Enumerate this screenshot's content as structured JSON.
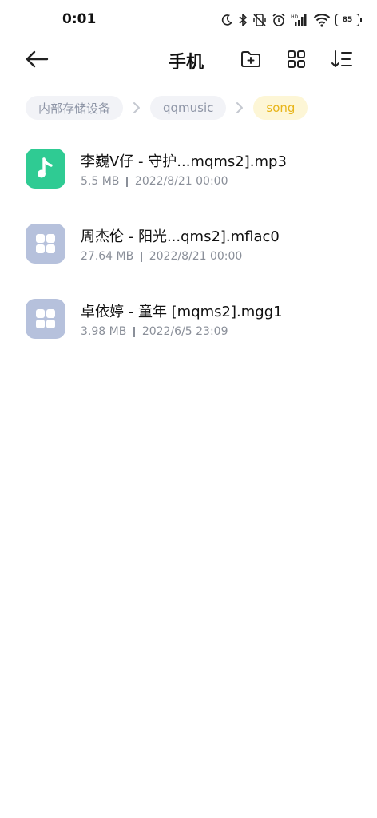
{
  "status_bar": {
    "time": "0:01",
    "battery": "85",
    "icons": [
      "moon-icon",
      "bluetooth-icon",
      "vibrate-off-icon",
      "alarm-icon",
      "signal-icon",
      "wifi-icon",
      "battery-icon"
    ]
  },
  "toolbar": {
    "title": "手机",
    "icons": [
      "back-arrow-icon",
      "new-folder-icon",
      "grid-view-icon",
      "sort-icon"
    ]
  },
  "breadcrumb": [
    {
      "label": "内部存储设备"
    },
    {
      "label": "qqmusic"
    },
    {
      "label": "song"
    }
  ],
  "files": [
    {
      "name": "李巍V仔 - 守护...mqms2].mp3",
      "size": "5.5 MB",
      "date": "2022/8/21 00:00",
      "icon": "music-note-icon"
    },
    {
      "name": "周杰伦 - 阳光...qms2].mflac0",
      "size": "27.64 MB",
      "date": "2022/8/21 00:00",
      "icon": "generic-file-icon"
    },
    {
      "name": "卓依婷 - 童年 [mqms2].mgg1",
      "size": "3.98 MB",
      "date": "2022/6/5 23:09",
      "icon": "generic-file-icon"
    }
  ],
  "colors": {
    "music_icon_bg": "#2fcb93",
    "generic_icon_bg": "#b6c1dc",
    "active_crumb_text": "#e8b51a",
    "active_crumb_bg": "#fdf6d6"
  }
}
